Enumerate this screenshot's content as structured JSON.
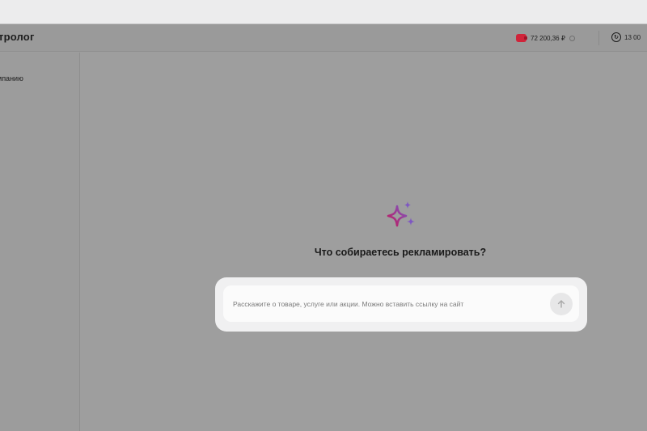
{
  "header": {
    "logo": "тролог",
    "balance": "72 200,36 ₽",
    "bonus": "13 00"
  },
  "sidebar": {
    "items": [
      {
        "label": "мпанию"
      }
    ]
  },
  "main": {
    "title": "Что собираетесь рекламировать?",
    "input": {
      "value": "",
      "placeholder": "Расскажите о товаре, услуге или акции. Можно вставить ссылку на сайт"
    }
  },
  "colors": {
    "overlay": "#9c9c9c",
    "wallet": "#d0243a",
    "sparkle_start": "#c2185b",
    "sparkle_end": "#7e57c2"
  },
  "icons": {
    "wallet": "wallet-icon",
    "bonus": "bonus-icon",
    "sparkle": "sparkle-icon",
    "send": "arrow-up-icon"
  }
}
